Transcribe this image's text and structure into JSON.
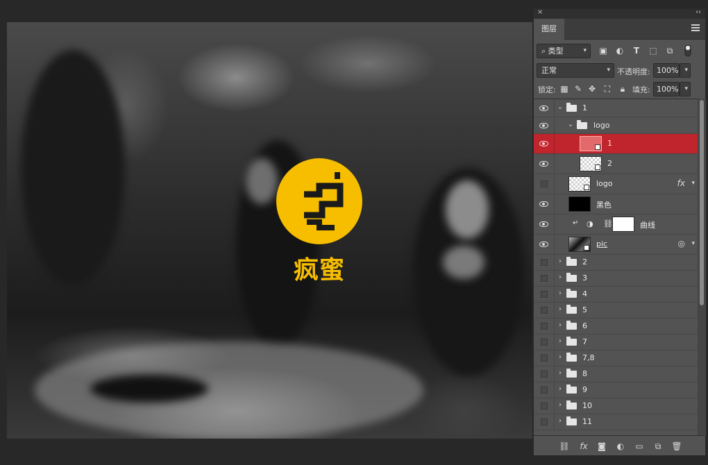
{
  "canvas": {
    "logo_text": "疯蜜",
    "logo_color": "#f7be00"
  },
  "panel": {
    "tab_label": "图层",
    "close_glyph": "×",
    "collapse_glyph": "‹‹",
    "filter": {
      "label": "类型"
    },
    "blend_mode": "正常",
    "opacity_label": "不透明度:",
    "opacity_value": "100%",
    "lock_label": "锁定:",
    "fill_label": "填充:",
    "fill_value": "100%",
    "selected_color": "#c0242c",
    "layers": [
      {
        "name": "1",
        "type": "group",
        "visible": true,
        "expanded": true
      },
      {
        "name": "logo",
        "type": "group",
        "visible": true,
        "expanded": true
      },
      {
        "name": "1",
        "type": "smart-object",
        "visible": true,
        "selected": true
      },
      {
        "name": "2",
        "type": "smart-object",
        "visible": true
      },
      {
        "name": "logo",
        "type": "smart-object",
        "visible": false,
        "has_fx": true
      },
      {
        "name": "黑色",
        "type": "layer",
        "visible": true,
        "fill": "#000000"
      },
      {
        "name": "曲线",
        "type": "adjustment",
        "visible": true,
        "clipped": true
      },
      {
        "name": "pic",
        "type": "smart-object",
        "visible": true
      },
      {
        "name": "2",
        "type": "group",
        "visible": false
      },
      {
        "name": "3",
        "type": "group",
        "visible": false
      },
      {
        "name": "4",
        "type": "group",
        "visible": false
      },
      {
        "name": "5",
        "type": "group",
        "visible": false
      },
      {
        "name": "6",
        "type": "group",
        "visible": false
      },
      {
        "name": "7",
        "type": "group",
        "visible": false
      },
      {
        "name": "7,8",
        "type": "group",
        "visible": false
      },
      {
        "name": "8",
        "type": "group",
        "visible": false
      },
      {
        "name": "9",
        "type": "group",
        "visible": false
      },
      {
        "name": "10",
        "type": "group",
        "visible": false
      },
      {
        "name": "11",
        "type": "group",
        "visible": false
      }
    ]
  }
}
